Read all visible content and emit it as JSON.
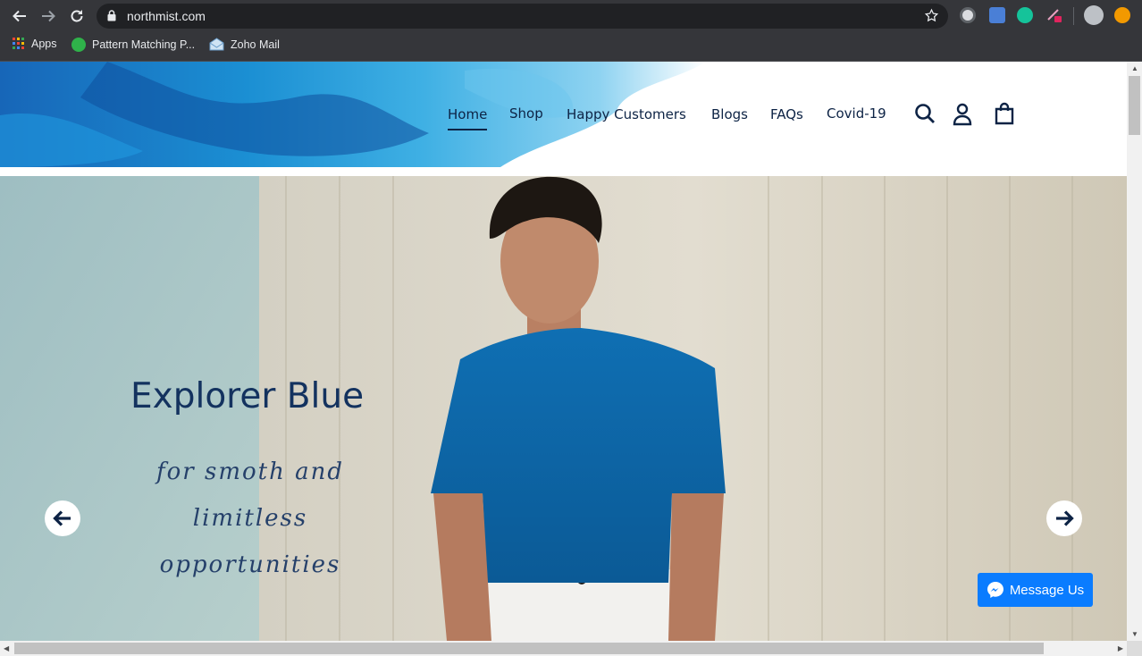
{
  "browser": {
    "url": "northmist.com",
    "bookmarks": [
      {
        "label": "Apps",
        "icon": "apps-grid-icon"
      },
      {
        "label": "Pattern Matching P...",
        "icon": "pattern-matching-favicon"
      },
      {
        "label": "Zoho Mail",
        "icon": "zoho-mail-favicon"
      }
    ]
  },
  "site": {
    "nav": [
      {
        "label": "Home",
        "active": true
      },
      {
        "label": "Shop"
      },
      {
        "label": "Happy Customers"
      },
      {
        "label": "Blogs"
      },
      {
        "label": "FAQs"
      },
      {
        "label": "Covid-19"
      }
    ],
    "header_icons": [
      "search-icon",
      "account-icon",
      "cart-icon"
    ]
  },
  "hero": {
    "title": "Explorer Blue",
    "tagline_line1": "for smoth and",
    "tagline_line2": "limitless",
    "tagline_line3": "opportunities"
  },
  "messenger": {
    "label": "Message Us"
  },
  "colors": {
    "chrome": "#35363a",
    "omnibox": "#202124",
    "brand_navy": "#0d2345",
    "messenger_blue": "#0a7cff",
    "shirt_blue": "#1268a8"
  }
}
